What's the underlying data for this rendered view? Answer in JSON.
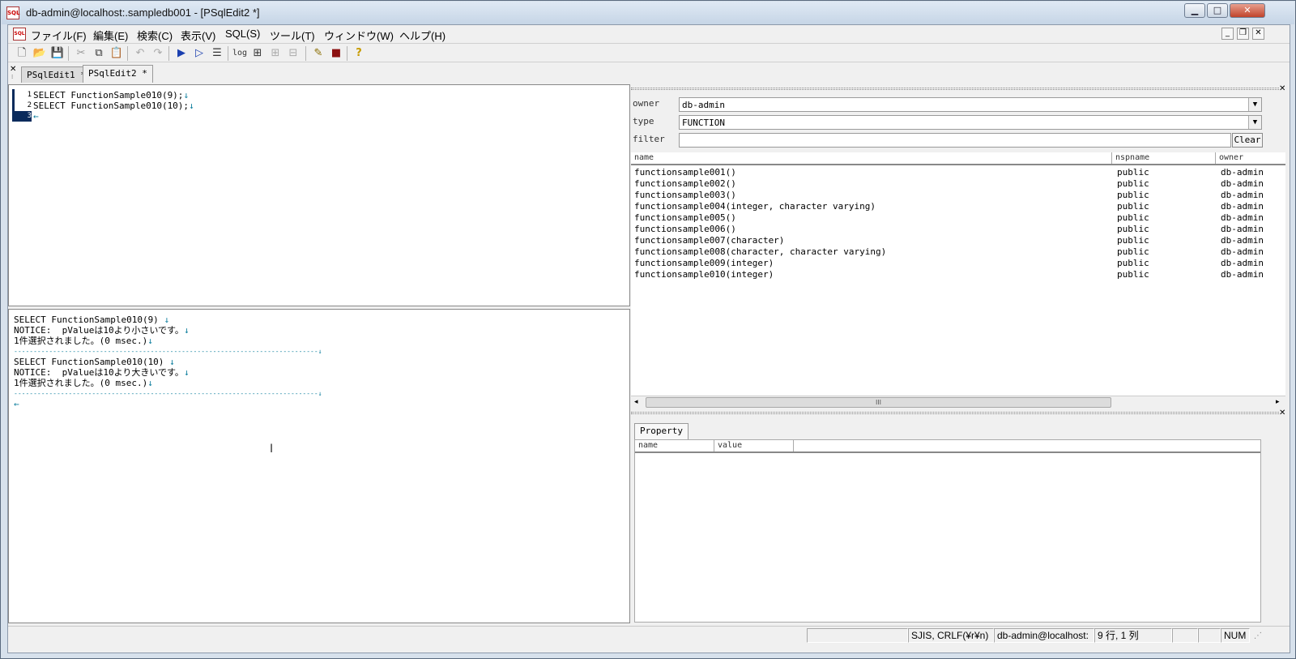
{
  "window": {
    "title": "db-admin@localhost:.sampledb001 - [PSqlEdit2 *]",
    "controls": {
      "minimize": "▁",
      "maximize": "□",
      "close": "✕"
    }
  },
  "menu": [
    {
      "label": "ファイル(F)"
    },
    {
      "label": "編集(E)"
    },
    {
      "label": "検索(C)"
    },
    {
      "label": "表示(V)"
    },
    {
      "label": "SQL(S)"
    },
    {
      "label": "ツール(T)"
    },
    {
      "label": "ウィンドウ(W)"
    },
    {
      "label": "ヘルプ(H)"
    }
  ],
  "toolbar": {
    "log_label": "log"
  },
  "tabs": [
    {
      "label": "PSqlEdit1 *",
      "active": false
    },
    {
      "label": "PSqlEdit2 *",
      "active": true
    }
  ],
  "editor": {
    "lines": [
      {
        "num": "1",
        "text": "SELECT FunctionSample010(9);",
        "eol": "↓"
      },
      {
        "num": "2",
        "text": "SELECT FunctionSample010(10);",
        "eol": "↓"
      },
      {
        "num": "3",
        "text": "",
        "eol": "←"
      }
    ]
  },
  "output": {
    "lines": [
      {
        "text": "SELECT FunctionSample010(9)",
        "eol": "↓"
      },
      {
        "text": "NOTICE:  pValueは10より小さいです。",
        "eol": "↓"
      },
      {
        "text": "1件選択されました。(0 msec.)",
        "eol": "↓"
      },
      {
        "text": "------------------------------------------------------------------------------",
        "eol": "↓"
      },
      {
        "text": "SELECT FunctionSample010(10)",
        "eol": "↓"
      },
      {
        "text": "NOTICE:  pValueは10より大きいです。",
        "eol": "↓"
      },
      {
        "text": "1件選択されました。(0 msec.)",
        "eol": "↓"
      },
      {
        "text": "------------------------------------------------------------------------------",
        "eol": "↓"
      },
      {
        "text": "",
        "eol": "←"
      }
    ]
  },
  "object_browser": {
    "owner_label": "owner",
    "owner_value": "db-admin",
    "type_label": "type",
    "type_value": "FUNCTION",
    "filter_label": "filter",
    "filter_value": "",
    "clear_label": "Clear",
    "columns": [
      "name",
      "nspname",
      "owner"
    ],
    "rows": [
      {
        "name": "functionsample001()",
        "nspname": "public",
        "owner": "db-admin"
      },
      {
        "name": "functionsample002()",
        "nspname": "public",
        "owner": "db-admin"
      },
      {
        "name": "functionsample003()",
        "nspname": "public",
        "owner": "db-admin"
      },
      {
        "name": "functionsample004(integer, character varying)",
        "nspname": "public",
        "owner": "db-admin"
      },
      {
        "name": "functionsample005()",
        "nspname": "public",
        "owner": "db-admin"
      },
      {
        "name": "functionsample006()",
        "nspname": "public",
        "owner": "db-admin"
      },
      {
        "name": "functionsample007(character)",
        "nspname": "public",
        "owner": "db-admin"
      },
      {
        "name": "functionsample008(character, character varying)",
        "nspname": "public",
        "owner": "db-admin"
      },
      {
        "name": "functionsample009(integer)",
        "nspname": "public",
        "owner": "db-admin"
      },
      {
        "name": "functionsample010(integer)",
        "nspname": "public",
        "owner": "db-admin"
      }
    ],
    "scroll_thumb": "III"
  },
  "property_panel": {
    "tab_label": "Property",
    "columns": [
      "name",
      "value"
    ]
  },
  "statusbar": {
    "encoding": "SJIS, CRLF(¥r¥n)",
    "connection": "db-admin@localhost:",
    "position": "9 行, 1 列",
    "num": "NUM"
  }
}
